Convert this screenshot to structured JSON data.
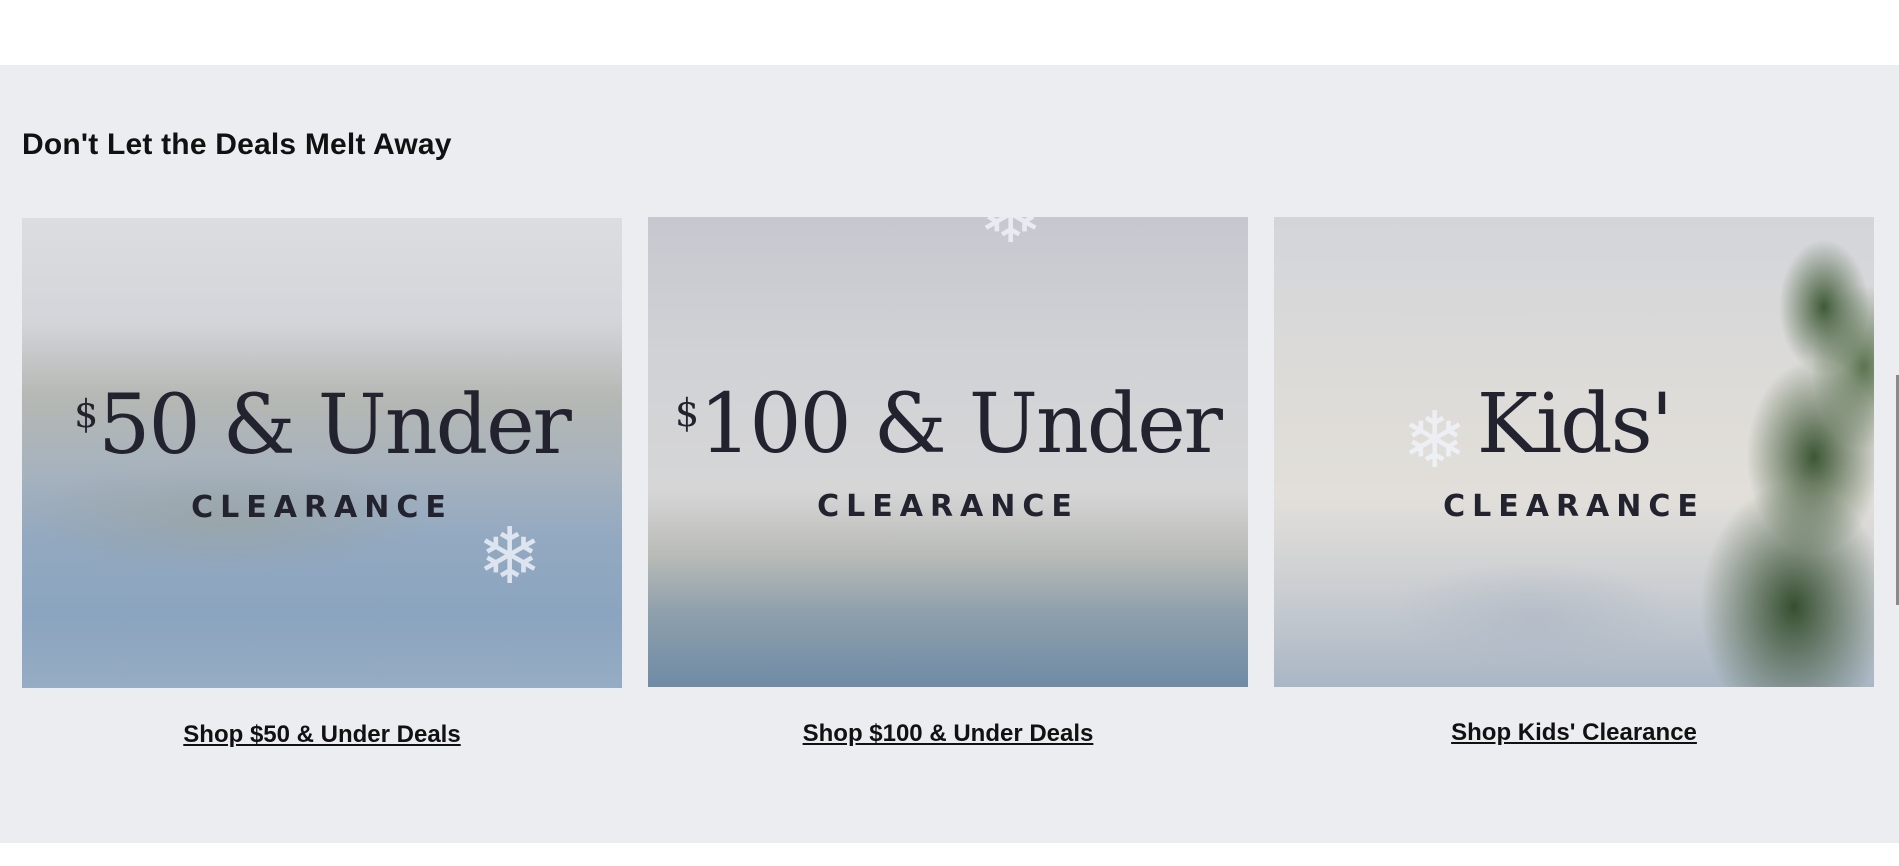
{
  "section": {
    "title": "Don't Let the Deals Melt Away",
    "cards": [
      {
        "big_symbol": "$",
        "big_text": "50 & Under",
        "sub_text": "CLEARANCE",
        "link_label": "Shop $50 & Under Deals"
      },
      {
        "big_symbol": "$",
        "big_text": "100 & Under",
        "sub_text": "CLEARANCE",
        "link_label": "Shop $100 & Under Deals"
      },
      {
        "big_symbol": "",
        "big_text": "Kids'",
        "sub_text": "CLEARANCE",
        "link_label": "Shop Kids' Clearance"
      }
    ]
  },
  "icons": {
    "snowflake": "snowflake-icon"
  },
  "colors": {
    "section_bg": "#ecedf1",
    "text_dark": "#23232f",
    "title": "#111111"
  }
}
